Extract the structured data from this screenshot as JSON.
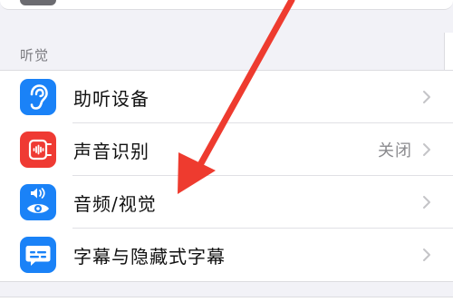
{
  "section": {
    "header": "听觉"
  },
  "rows": [
    {
      "label": "助听设备",
      "icon": "ear-icon",
      "icon_color": "#1a82f7",
      "value": ""
    },
    {
      "label": "声音识别",
      "icon": "sound-waveform-icon",
      "icon_color": "#ef3a33",
      "value": "关闭"
    },
    {
      "label": "音频/视觉",
      "icon": "speaker-eye-icon",
      "icon_color": "#1a82f7",
      "value": ""
    },
    {
      "label": "字幕与隐藏式字幕",
      "icon": "caption-bubble-icon",
      "icon_color": "#1a82f7",
      "value": ""
    }
  ],
  "annotation": {
    "arrow_color": "#ee3b2f"
  }
}
